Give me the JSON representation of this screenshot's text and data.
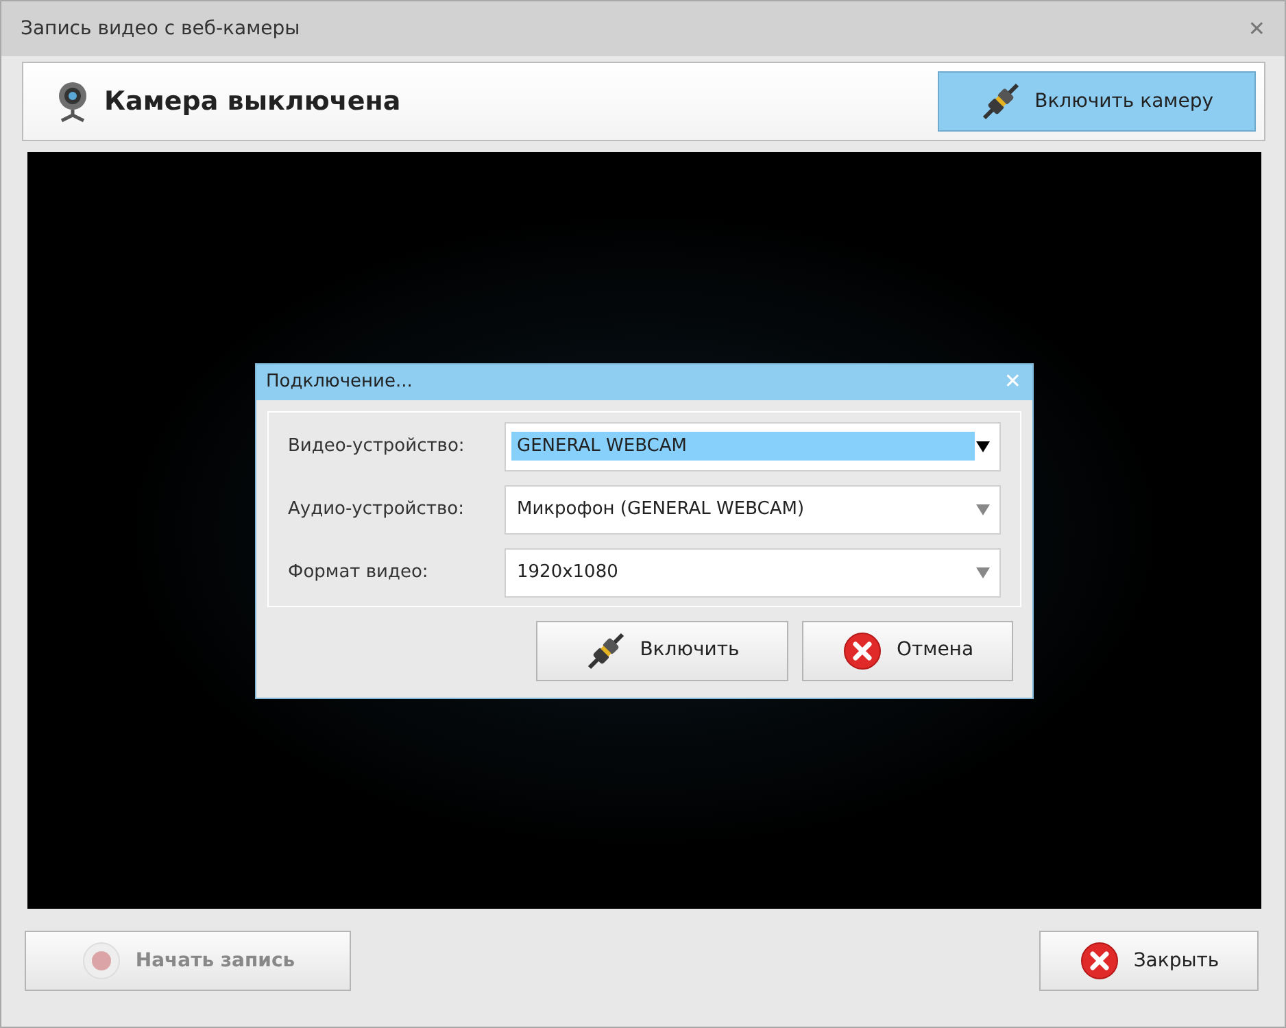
{
  "window": {
    "title": "Запись видео с веб-камеры",
    "close": "✕"
  },
  "header": {
    "status": "Камера выключена",
    "button": {
      "label": "Включить камеру",
      "kind": "plug",
      "highlighted": true
    }
  },
  "dialog": {
    "title": "Подключение...",
    "close": "✕",
    "fields": [
      {
        "label": "Видео-устройство:",
        "value": "GENERAL WEBCAM",
        "focused": true
      },
      {
        "label": "Аудио-устройство:",
        "value": "Микрофон (GENERAL WEBCAM)",
        "focused": false
      },
      {
        "label": "Формат видео:",
        "value": "1920x1080",
        "focused": false
      }
    ],
    "buttons": [
      {
        "label": "Включить",
        "kind": "plug"
      },
      {
        "label": "Отмена",
        "kind": "cancel"
      }
    ]
  },
  "footer": {
    "buttons": [
      {
        "label": "Начать запись",
        "kind": "record",
        "disabled": true
      },
      {
        "label": "Закрыть",
        "kind": "cancel",
        "disabled": false
      }
    ]
  }
}
